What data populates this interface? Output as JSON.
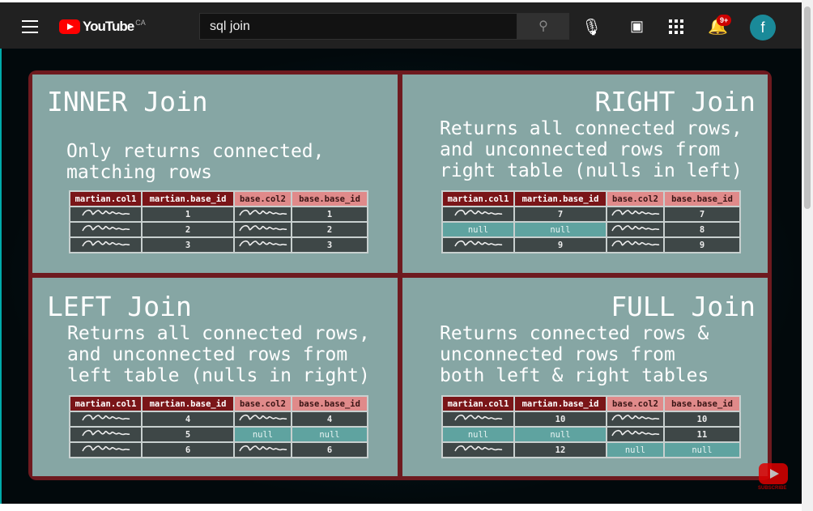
{
  "header": {
    "logo": "YouTube",
    "region": "CA",
    "search_value": "sql join",
    "notification_count": "9+",
    "avatar_letter": "f"
  },
  "icons": [
    "menu-icon",
    "youtube-logo",
    "search-icon",
    "mic-icon",
    "create-video-icon",
    "apps-icon",
    "bell-icon"
  ],
  "colors": {
    "panel": "#86a6a4",
    "border": "#6e1a1f",
    "martian_header": "#7a1518",
    "base_header": "#e08a8a",
    "cell": "#3e4747",
    "null_cell": "#5fa3a0"
  },
  "headers": [
    "martian.col1",
    "martian.base_id",
    "base.col2",
    "base.base_id"
  ],
  "panels": [
    {
      "title": "INNER Join",
      "desc": "Only returns connected,\nmatching rows",
      "rows": [
        [
          "~",
          "1",
          "~",
          "1"
        ],
        [
          "~",
          "2",
          "~",
          "2"
        ],
        [
          "~",
          "3",
          "~",
          "3"
        ]
      ]
    },
    {
      "title": "RIGHT Join",
      "desc": "Returns all connected rows,\nand unconnected rows from\nright table (nulls in left)",
      "rows": [
        [
          "~",
          "7",
          "~",
          "7"
        ],
        [
          "null",
          "null",
          "~",
          "8"
        ],
        [
          "~",
          "9",
          "~",
          "9"
        ]
      ]
    },
    {
      "title": "LEFT Join",
      "desc": "Returns all connected rows,\nand unconnected rows from\nleft table (nulls in right)",
      "rows": [
        [
          "~",
          "4",
          "~",
          "4"
        ],
        [
          "~",
          "5",
          "null",
          "null"
        ],
        [
          "~",
          "6",
          "~",
          "6"
        ]
      ]
    },
    {
      "title": "FULL Join",
      "desc": "Returns connected rows &\nunconnected rows from\nboth left & right tables",
      "rows": [
        [
          "~",
          "10",
          "~",
          "10"
        ],
        [
          "null",
          "null",
          "~",
          "11"
        ],
        [
          "~",
          "12",
          "null",
          "null"
        ]
      ]
    }
  ],
  "subscribe": "SUBSCRIBE"
}
